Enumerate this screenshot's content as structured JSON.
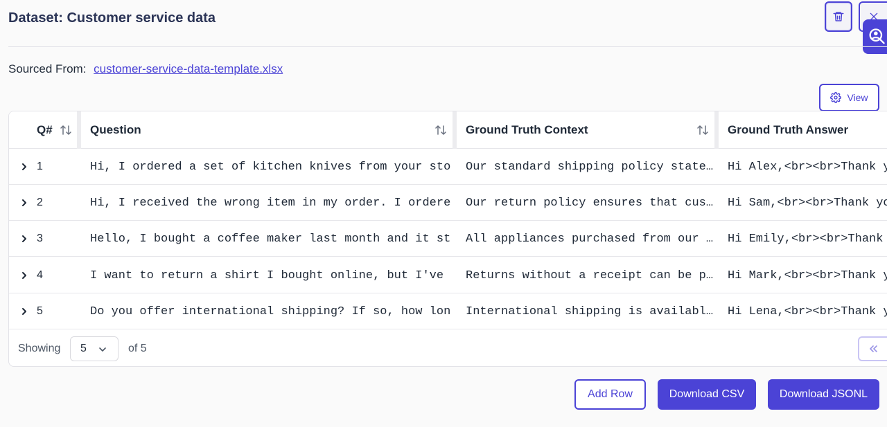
{
  "header": {
    "title": "Dataset: Customer service data"
  },
  "source": {
    "label": "Sourced From:",
    "file": "customer-service-data-template.xlsx"
  },
  "toolbar": {
    "view_label": "View"
  },
  "table": {
    "columns": [
      "Q#",
      "Question",
      "Ground Truth Context",
      "Ground Truth Answer"
    ],
    "rows": [
      {
        "q": "1",
        "question": "Hi, I ordered a set of kitchen knives from your sto…",
        "context": "Our standard shipping policy state…",
        "answer": "Hi Alex,<br><br>Thank y"
      },
      {
        "q": "2",
        "question": "Hi, I received the wrong item in my order. I ordere…",
        "context": "Our return policy ensures that cus…",
        "answer": "Hi Sam,<br><br>Thank yo"
      },
      {
        "q": "3",
        "question": "Hello, I bought a coffee maker last month and it st…",
        "context": "All appliances purchased from our …",
        "answer": "Hi Emily,<br><br>Thank"
      },
      {
        "q": "4",
        "question": "I want to return a shirt I bought online, but I've …",
        "context": "Returns without a receipt can be p…",
        "answer": "Hi Mark,<br><br>Thank y"
      },
      {
        "q": "5",
        "question": "Do you offer international shipping? If so, how lon…",
        "context": "International shipping is availabl…",
        "answer": "Hi Lena,<br><br>Thank y"
      }
    ]
  },
  "pagination": {
    "showing_label": "Showing",
    "page_size": "5",
    "of_label": "of 5"
  },
  "actions": {
    "add_row": "Add Row",
    "download_csv": "Download CSV",
    "download_jsonl": "Download JSONL"
  },
  "colors": {
    "accent": "#4b43d6",
    "title": "#2b3456"
  }
}
